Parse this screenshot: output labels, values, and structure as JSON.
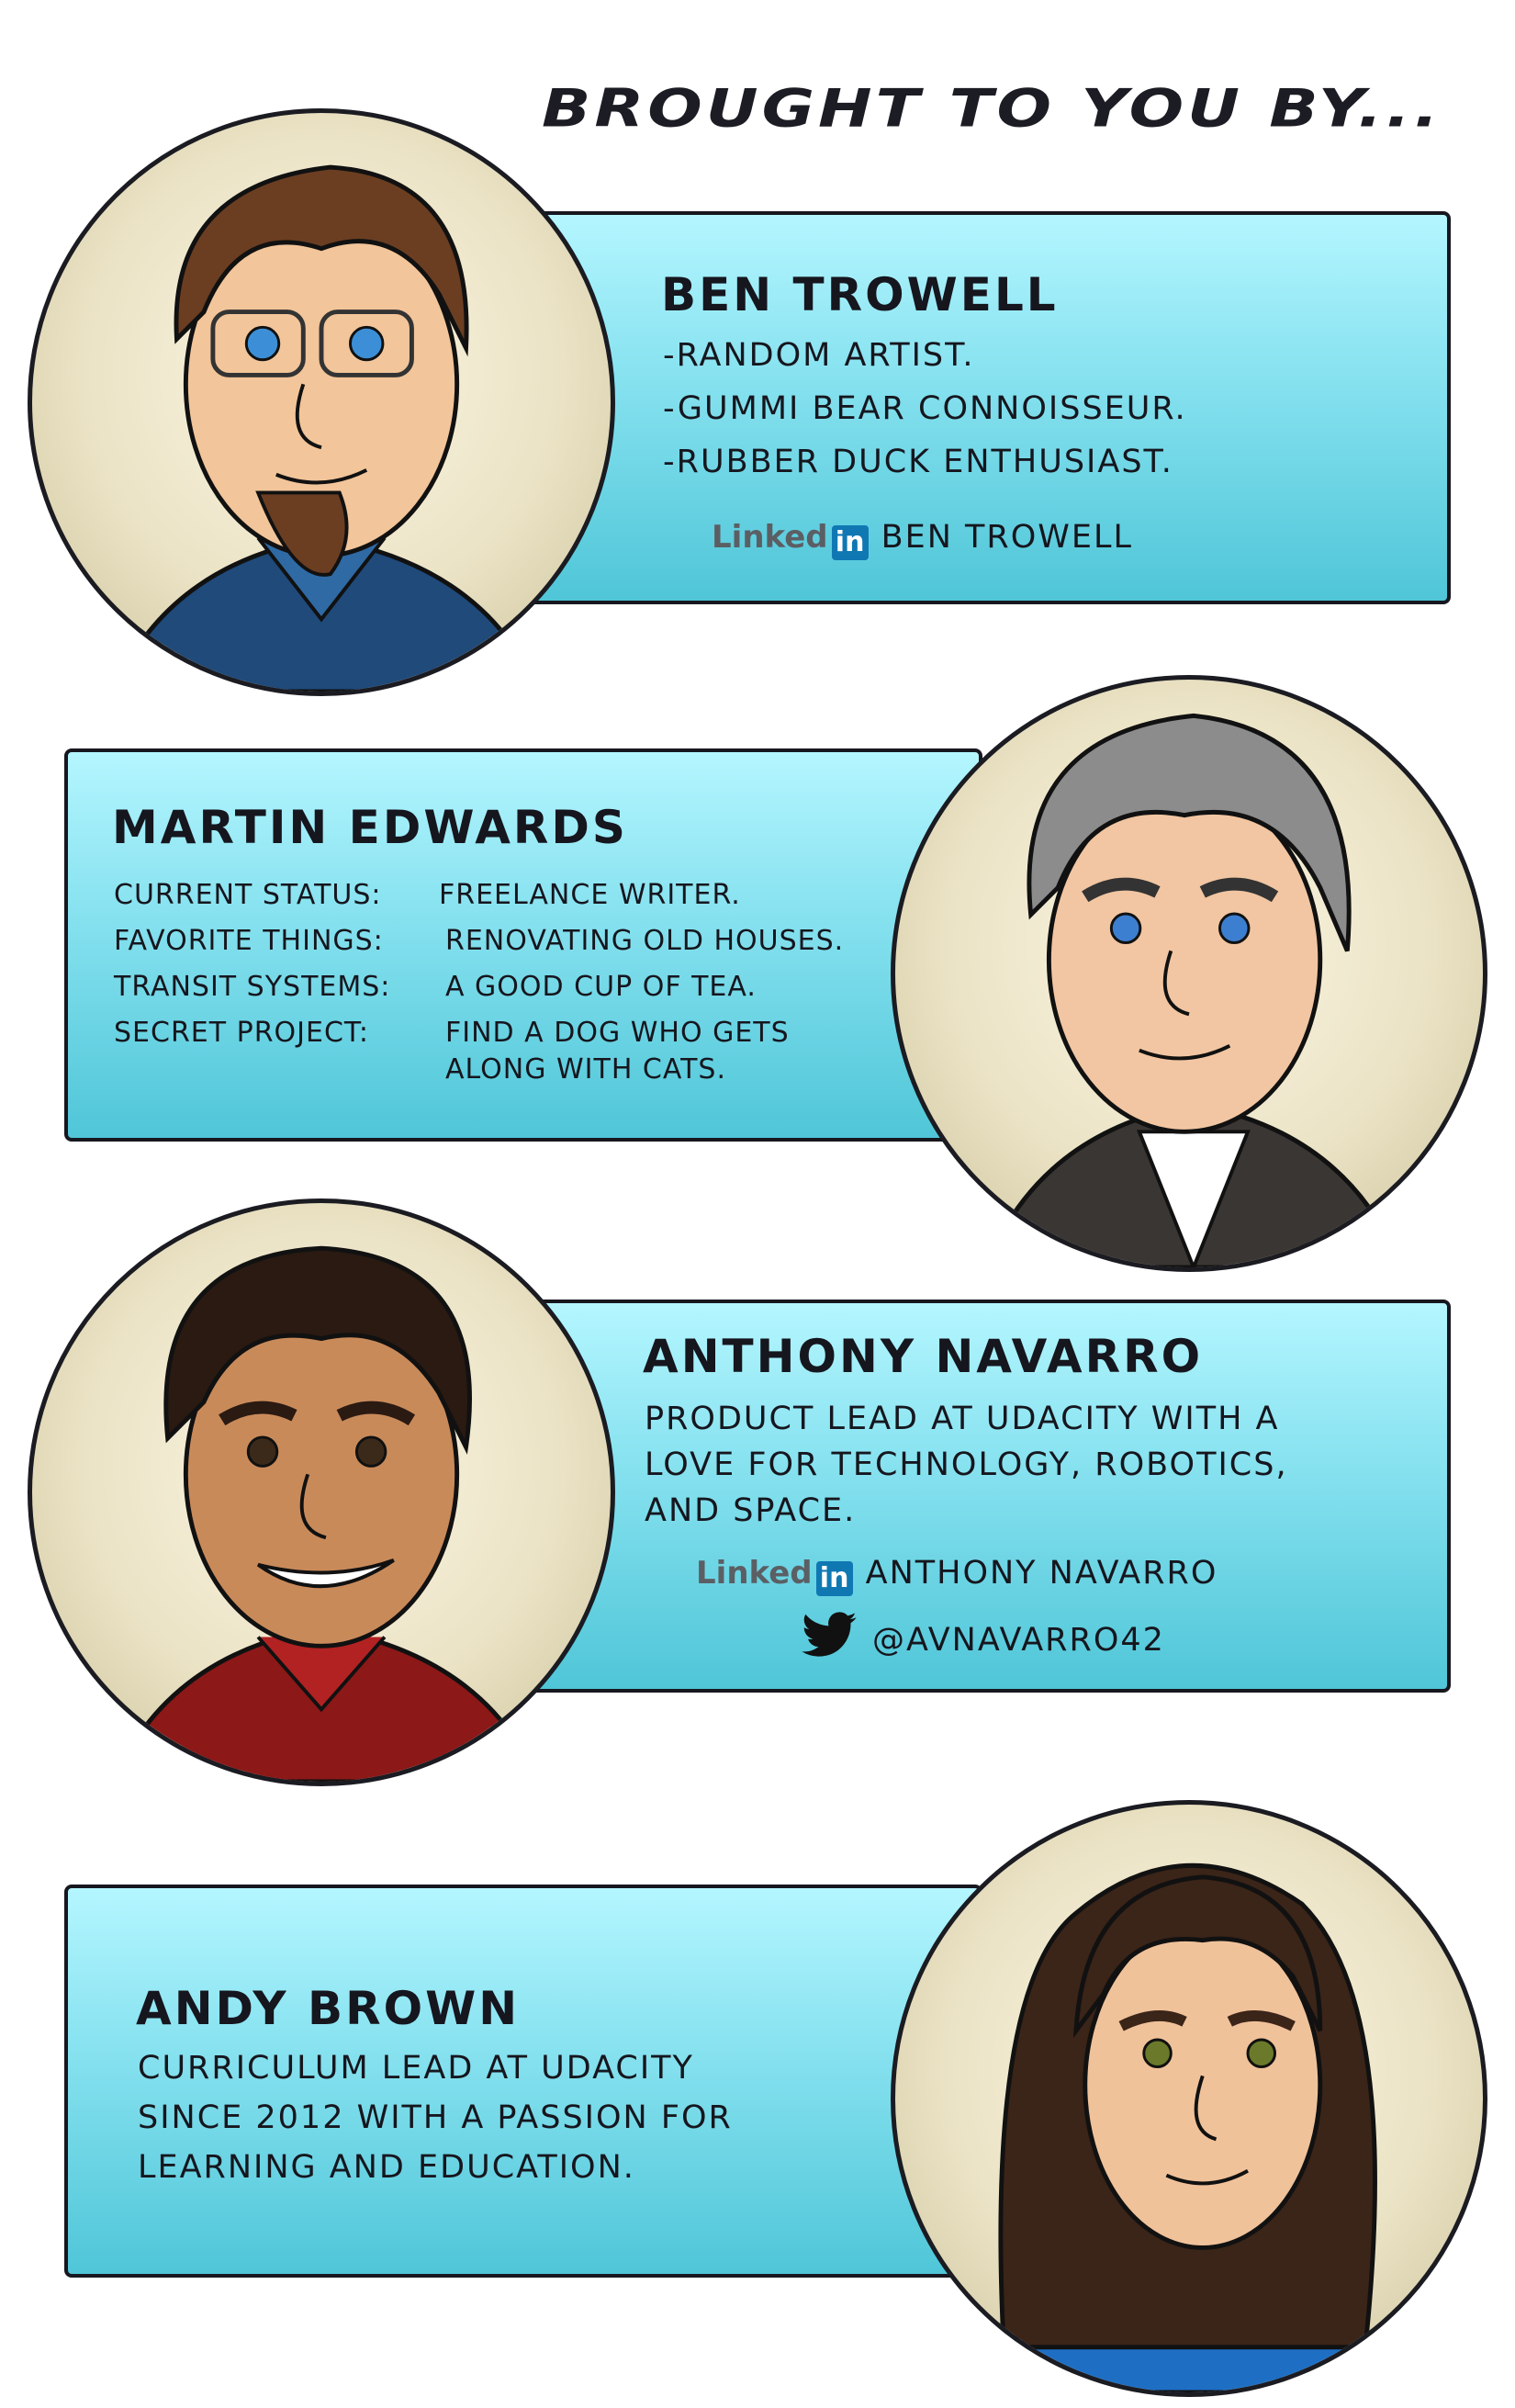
{
  "heading": "BROUGHT TO YOU BY...",
  "linkedin_logo_text": "Linked",
  "linkedin_logo_box": "in",
  "colors": {
    "card_top": "#b4f6ff",
    "card_bottom": "#4fc6d8",
    "outline": "#17171f",
    "linkedin_blue": "#0f78b3",
    "twitter_black": "#111111"
  },
  "people": {
    "ben": {
      "name": "BEN TROWELL",
      "lines": [
        "-RANDOM ARTIST.",
        "-GUMMI BEAR CONNOISSEUR.",
        "-RUBBER DUCK ENTHUSIAST."
      ],
      "linkedin": "BEN TROWELL"
    },
    "martin": {
      "name": "MARTIN EDWARDS",
      "rows": [
        {
          "label": "CURRENT STATUS:",
          "value": "FREELANCE WRITER."
        },
        {
          "label": "FAVORITE THINGS:",
          "value": "RENOVATING OLD HOUSES."
        },
        {
          "label": "TRANSIT SYSTEMS:",
          "value": "A GOOD CUP OF TEA."
        },
        {
          "label": "SECRET PROJECT:",
          "value": "FIND A DOG WHO GETS"
        }
      ],
      "continuation": "ALONG WITH CATS."
    },
    "anthony": {
      "name": "ANTHONY NAVARRO",
      "bio": [
        "PRODUCT LEAD AT UDACITY WITH A",
        "LOVE FOR TECHNOLOGY, ROBOTICS,",
        "AND SPACE."
      ],
      "linkedin": "ANTHONY NAVARRO",
      "twitter": "@AVNAVARRO42"
    },
    "andy": {
      "name": "ANDY BROWN",
      "bio": [
        "CURRICULUM LEAD AT UDACITY",
        "SINCE 2012 WITH A PASSION FOR",
        "LEARNING AND EDUCATION."
      ]
    }
  }
}
